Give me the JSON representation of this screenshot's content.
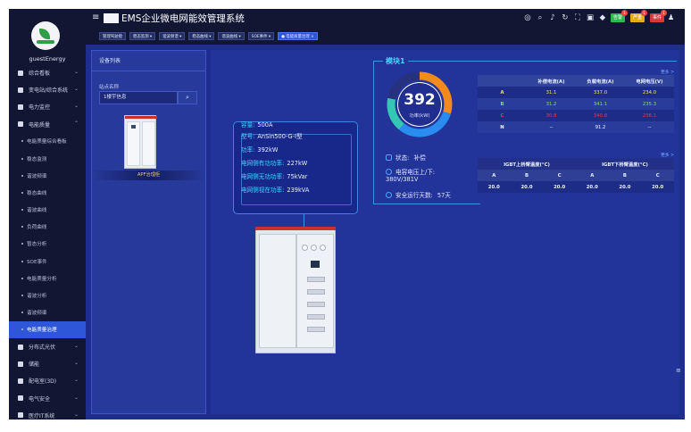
{
  "sidebar": {
    "username": "guestEnergy",
    "items": [
      {
        "label": "综合看板",
        "type": "top",
        "icon": "dashboard-icon"
      },
      {
        "label": "变电站/综合系统",
        "type": "top",
        "icon": "home-icon"
      },
      {
        "label": "电力监控",
        "type": "top",
        "icon": "gear-icon"
      },
      {
        "label": "电能质量",
        "type": "top-open",
        "icon": "folder-icon"
      },
      {
        "label": "电能质量综合看板",
        "type": "sub"
      },
      {
        "label": "稳态监测",
        "type": "sub"
      },
      {
        "label": "谐波频谱",
        "type": "sub"
      },
      {
        "label": "稳态曲线",
        "type": "sub"
      },
      {
        "label": "谐波曲线",
        "type": "sub"
      },
      {
        "label": "负荷曲线",
        "type": "sub"
      },
      {
        "label": "暂态分析",
        "type": "sub"
      },
      {
        "label": "SOE事件",
        "type": "sub"
      },
      {
        "label": "电能质量分析",
        "type": "sub"
      },
      {
        "label": "谐波分析",
        "type": "sub"
      },
      {
        "label": "谐波频谱",
        "type": "sub"
      },
      {
        "label": "电能质量治理",
        "type": "sub-active"
      },
      {
        "label": "分布式光伏",
        "type": "top",
        "icon": "solar-icon"
      },
      {
        "label": "储能",
        "type": "top",
        "icon": "battery-icon"
      },
      {
        "label": "配电室(3D)",
        "type": "top",
        "icon": "room-icon"
      },
      {
        "label": "电气安全",
        "type": "top",
        "icon": "safety-icon"
      },
      {
        "label": "医疗IT系统",
        "type": "top",
        "icon": "medical-icon"
      }
    ]
  },
  "header": {
    "title": "EMS企业微电网能效管理系统",
    "tabs": [
      {
        "label": "管理驾驶舱",
        "active": false
      },
      {
        "label": "稳态监测 ▾",
        "active": false
      },
      {
        "label": "谐波频谱 ▾",
        "active": false
      },
      {
        "label": "稳态曲线 ▾",
        "active": false
      },
      {
        "label": "谐波曲线 ▾",
        "active": false
      },
      {
        "label": "SOE事件 ▾",
        "active": false
      },
      {
        "label": "● 电能质量治理 ×",
        "active": true
      }
    ],
    "badges": [
      {
        "label": "告警",
        "count": "1",
        "color": "#2eb84f"
      },
      {
        "label": "严重",
        "count": "1",
        "color": "#e0ae1a"
      },
      {
        "label": "事件",
        "count": "1",
        "color": "#d23b3b"
      }
    ]
  },
  "device_panel": {
    "title": "设备列表",
    "station_label": "站点名称",
    "station_value": "1楼宇信息",
    "device_caption": "APF治理柜"
  },
  "info": {
    "capacity_label": "容量:",
    "capacity": "500A",
    "model_label": "型号:",
    "model": "AnSin500-G-I型",
    "power_label": "功率:",
    "power": "392kW",
    "active_label": "电网侧有功功率:",
    "active": "227kW",
    "reactive_label": "电网侧无功功率:",
    "reactive": "75kVar",
    "apparent_label": "电网侧视在功率:",
    "apparent": "239kVA"
  },
  "module": {
    "title": "模块1",
    "gauge_value": "392",
    "gauge_label": "功率(kW)",
    "gauge_fraction": 0.78,
    "status_label": "状态:",
    "status": "补偿",
    "voltage_label": "电容电压上/下:",
    "voltage": "380V/381V",
    "days_label": "安全运行天数:",
    "days": "57天",
    "more1": "更多 >",
    "more2": "更多 >"
  },
  "table1": {
    "headers": [
      "",
      "补偿电流(A)",
      "负载电流(A)",
      "电网电压(V)"
    ],
    "rows": [
      [
        "A",
        "31.1",
        "337.0",
        "234.0"
      ],
      [
        "B",
        "31.2",
        "341.1",
        "235.3"
      ],
      [
        "C",
        "30.8",
        "340.8",
        "236.1"
      ],
      [
        "N",
        "--",
        "91.2",
        "--"
      ]
    ]
  },
  "table2": {
    "groups": [
      "IGBT上桥臂温度(°C)",
      "IGBT下桥臂温度(°C)"
    ],
    "headers": [
      "A",
      "B",
      "C",
      "A",
      "B",
      "C"
    ],
    "values": [
      "20.0",
      "20.0",
      "20.0",
      "20.0",
      "20.0",
      "20.0"
    ]
  },
  "colors": {
    "sidebar_bg": "#111633",
    "content_bg": "#223399",
    "accent": "#2d56d8",
    "gauge_orange": "#f28a1e",
    "gauge_blue": "#2b8cf0",
    "gauge_teal": "#34c8b4"
  }
}
